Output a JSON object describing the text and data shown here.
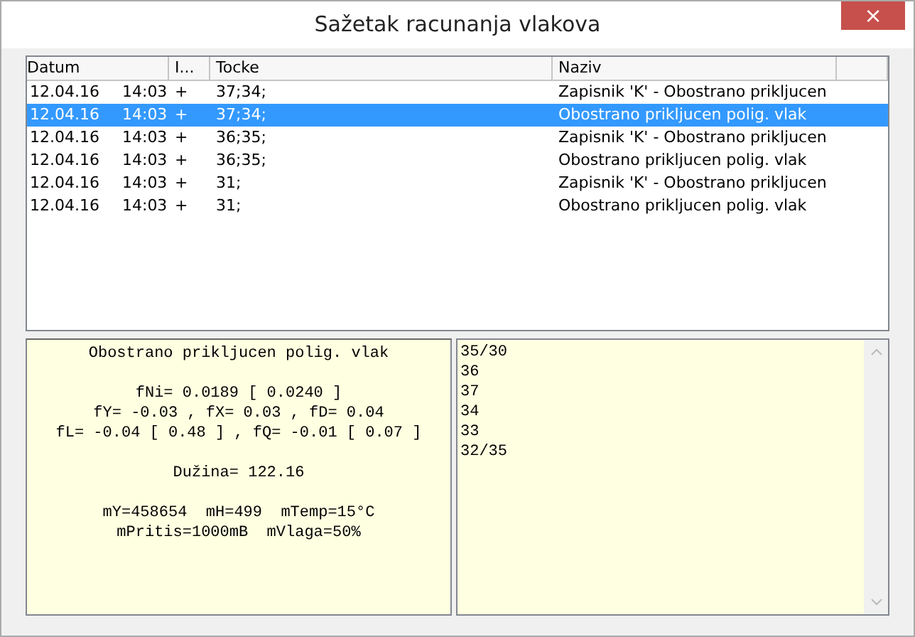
{
  "window": {
    "title": "Sažetak racunanja vlakova",
    "close": "×"
  },
  "table": {
    "columns": [
      "Datum",
      "I...",
      "Tocke",
      "Naziv"
    ],
    "rows": [
      {
        "date": "12.04.16",
        "time": "14:03",
        "i": "+",
        "tocke": "37;34;",
        "naziv": "Zapisnik 'K' - Obostrano prikljucen",
        "selected": false
      },
      {
        "date": "12.04.16",
        "time": "14:03",
        "i": "+",
        "tocke": "37;34;",
        "naziv": "Obostrano prikljucen polig. vlak",
        "selected": true
      },
      {
        "date": "12.04.16",
        "time": "14:03",
        "i": "+",
        "tocke": "36;35;",
        "naziv": "Zapisnik 'K' - Obostrano prikljucen",
        "selected": false
      },
      {
        "date": "12.04.16",
        "time": "14:03",
        "i": "+",
        "tocke": "36;35;",
        "naziv": "Obostrano prikljucen polig. vlak",
        "selected": false
      },
      {
        "date": "12.04.16",
        "time": "14:03",
        "i": "+",
        "tocke": "31;",
        "naziv": "Zapisnik 'K' - Obostrano prikljucen",
        "selected": false
      },
      {
        "date": "12.04.16",
        "time": "14:03",
        "i": "+",
        "tocke": "31;",
        "naziv": "Obostrano prikljucen polig. vlak",
        "selected": false
      }
    ]
  },
  "summary": {
    "sections": [
      [
        "Obostrano prikljucen polig. vlak"
      ],
      [
        "fNi= 0.0189 [ 0.0240 ]",
        "fY= -0.03 , fX= 0.03 , fD= 0.04",
        "fL= -0.04 [ 0.48 ] , fQ= -0.01 [ 0.07 ]"
      ],
      [
        "Dužina= 122.16"
      ],
      [
        "mY=458654  mH=499  mTemp=15°C",
        "mPritis=1000mB  mVlaga=50%"
      ]
    ]
  },
  "points": [
    "35/30",
    "36",
    "37",
    "34",
    "33",
    "32/35"
  ]
}
